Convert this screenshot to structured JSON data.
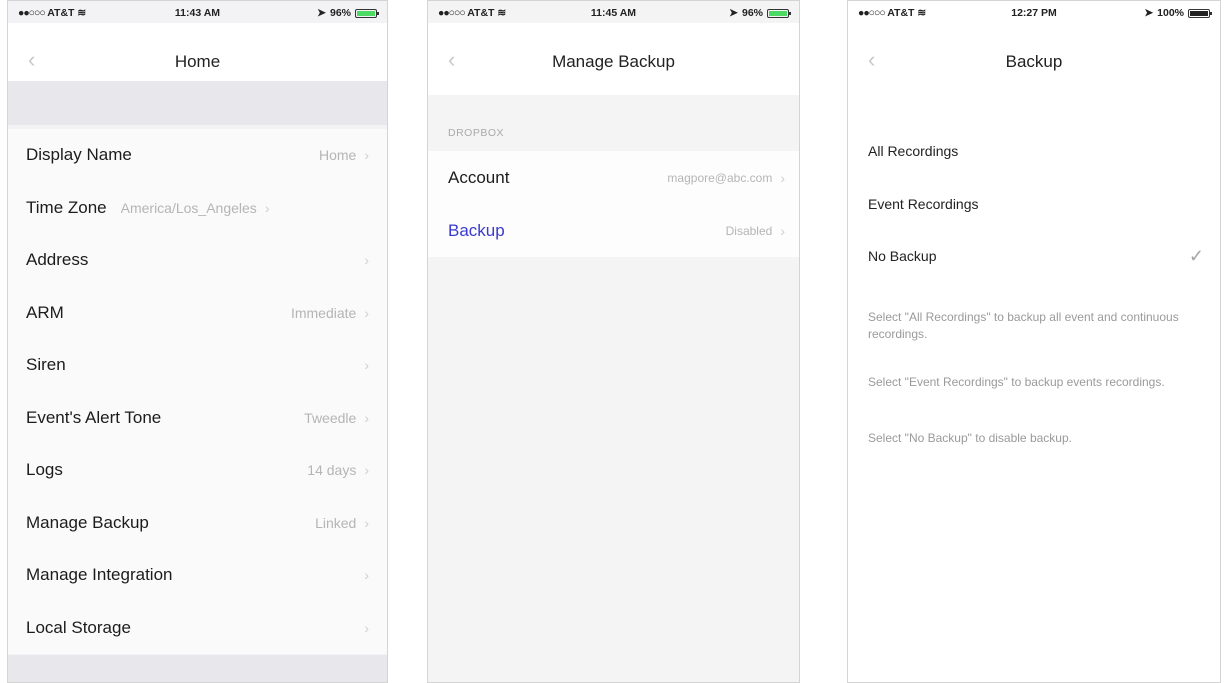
{
  "panels": [
    {
      "status": {
        "carrier": "AT&T",
        "time": "11:43 AM",
        "battery": "96%",
        "battery_color": "#4cd964"
      },
      "title": "Home",
      "rows": [
        {
          "label": "Display Name",
          "value": "Home"
        },
        {
          "label": "Time Zone",
          "value": "America/Los_Angeles"
        },
        {
          "label": "Address",
          "value": ""
        },
        {
          "label": "ARM",
          "value": "Immediate"
        },
        {
          "label": "Siren",
          "value": ""
        },
        {
          "label": "Event's Alert Tone",
          "value": "Tweedle"
        },
        {
          "label": "Logs",
          "value": "14 days"
        },
        {
          "label": "Manage Backup",
          "value": "Linked"
        },
        {
          "label": "Manage Integration",
          "value": ""
        },
        {
          "label": "Local Storage",
          "value": ""
        }
      ]
    },
    {
      "status": {
        "carrier": "AT&T",
        "time": "11:45 AM",
        "battery": "96%",
        "battery_color": "#4cd964"
      },
      "title": "Manage Backup",
      "section": "DROPBOX",
      "rows": [
        {
          "label": "Account",
          "value": "magpore@abc.com"
        },
        {
          "label": "Backup",
          "value": "Disabled",
          "accent": "#3a3ad0"
        }
      ]
    },
    {
      "status": {
        "carrier": "AT&T",
        "time": "12:27 PM",
        "battery": "100%",
        "battery_color": "#222222"
      },
      "title": "Backup",
      "options": [
        {
          "label": "All Recordings",
          "selected": false
        },
        {
          "label": "Event Recordings",
          "selected": false
        },
        {
          "label": "No Backup",
          "selected": true
        }
      ],
      "notes": [
        "Select \"All Recordings\" to backup all event and continuous recordings.",
        "Select \"Event Recordings\" to backup events recordings.",
        "Select \"No Backup\" to disable backup."
      ]
    }
  ],
  "icons": {
    "back": "chevron-left-icon",
    "disclosure": "chevron-right-icon",
    "check": "checkmark-icon"
  }
}
